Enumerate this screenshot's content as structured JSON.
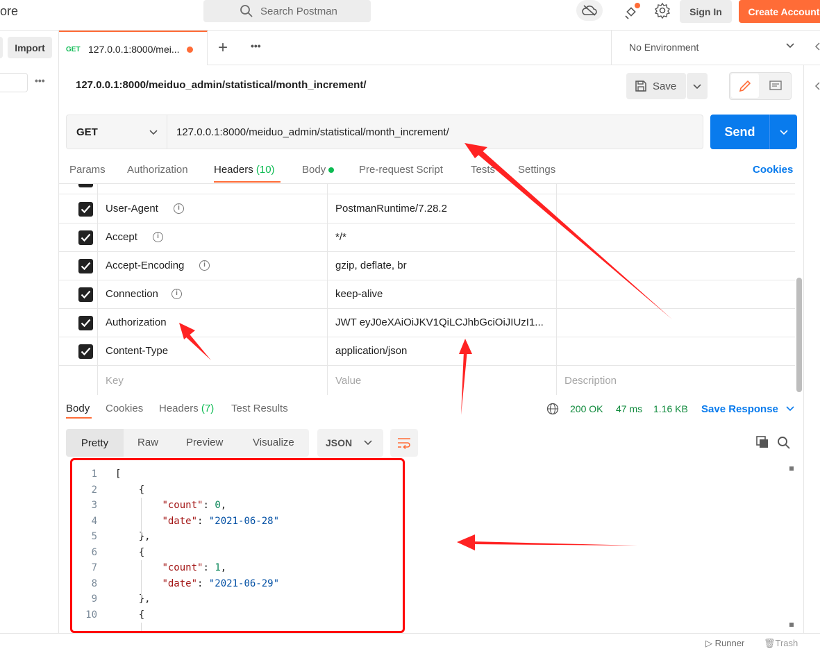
{
  "app": {
    "brand_partial": "ore",
    "search_placeholder": "Search Postman",
    "sign_in": "Sign In",
    "create_account": "Create Account"
  },
  "sidebar": {
    "import_label": "Import",
    "more": "•••"
  },
  "tabs": {
    "active": {
      "method": "GET",
      "title": "127.0.0.1:8000/mei...",
      "unsaved": true
    },
    "new_tab": "+",
    "more": "•••",
    "environment": "No Environment"
  },
  "request": {
    "title": "127.0.0.1:8000/meiduo_admin/statistical/month_increment/",
    "save_label": "Save",
    "method": "GET",
    "url": "127.0.0.1:8000/meiduo_admin/statistical/month_increment/",
    "send_label": "Send",
    "tabs": [
      "Params",
      "Authorization",
      "Headers",
      "Body",
      "Pre-request Script",
      "Tests",
      "Settings"
    ],
    "headers_count": "(10)",
    "active_tab": "Headers",
    "cookies_link": "Cookies"
  },
  "headers": [
    {
      "key": "User-Agent",
      "value": "PostmanRuntime/7.28.2",
      "checked": true,
      "info": true
    },
    {
      "key": "Accept",
      "value": "*/*",
      "checked": true,
      "info": true
    },
    {
      "key": "Accept-Encoding",
      "value": "gzip, deflate, br",
      "checked": true,
      "info": true
    },
    {
      "key": "Connection",
      "value": "keep-alive",
      "checked": true,
      "info": true
    },
    {
      "key": "Authorization",
      "value": "JWT eyJ0eXAiOiJKV1QiLCJhbGciOiJIUzI1...",
      "checked": true,
      "info": false
    },
    {
      "key": "Content-Type",
      "value": "application/json",
      "checked": true,
      "info": false
    }
  ],
  "headers_placeholder": {
    "key": "Key",
    "value": "Value",
    "description": "Description"
  },
  "response": {
    "tabs": [
      "Body",
      "Cookies",
      "Headers",
      "Test Results"
    ],
    "headers_count": "(7)",
    "status": "200 OK",
    "time": "47 ms",
    "size": "1.16 KB",
    "save_response": "Save Response",
    "views": [
      "Pretty",
      "Raw",
      "Preview",
      "Visualize"
    ],
    "format": "JSON",
    "lines": [
      {
        "n": "1",
        "parts": [
          [
            "p",
            "["
          ]
        ]
      },
      {
        "n": "2",
        "parts": [
          [
            "p",
            "    {"
          ]
        ]
      },
      {
        "n": "3",
        "parts": [
          [
            "p",
            "        "
          ],
          [
            "k",
            "\"count\""
          ],
          [
            "p",
            ": "
          ],
          [
            "n",
            "0"
          ],
          [
            "p",
            ","
          ]
        ]
      },
      {
        "n": "4",
        "parts": [
          [
            "p",
            "        "
          ],
          [
            "k",
            "\"date\""
          ],
          [
            "p",
            ": "
          ],
          [
            "s",
            "\"2021-06-28\""
          ]
        ]
      },
      {
        "n": "5",
        "parts": [
          [
            "p",
            "    },"
          ]
        ]
      },
      {
        "n": "6",
        "parts": [
          [
            "p",
            "    {"
          ]
        ]
      },
      {
        "n": "7",
        "parts": [
          [
            "p",
            "        "
          ],
          [
            "k",
            "\"count\""
          ],
          [
            "p",
            ": "
          ],
          [
            "n",
            "1"
          ],
          [
            "p",
            ","
          ]
        ]
      },
      {
        "n": "8",
        "parts": [
          [
            "p",
            "        "
          ],
          [
            "k",
            "\"date\""
          ],
          [
            "p",
            ": "
          ],
          [
            "s",
            "\"2021-06-29\""
          ]
        ]
      },
      {
        "n": "9",
        "parts": [
          [
            "p",
            "    },"
          ]
        ]
      },
      {
        "n": "10",
        "parts": [
          [
            "p",
            "    {"
          ]
        ]
      }
    ]
  },
  "footer": {
    "runner": "Runner",
    "trash": "Trash"
  },
  "colors": {
    "accent": "#ff6c37",
    "primary": "#097bed",
    "success": "#0cbb52",
    "annotation": "#ff0000"
  }
}
